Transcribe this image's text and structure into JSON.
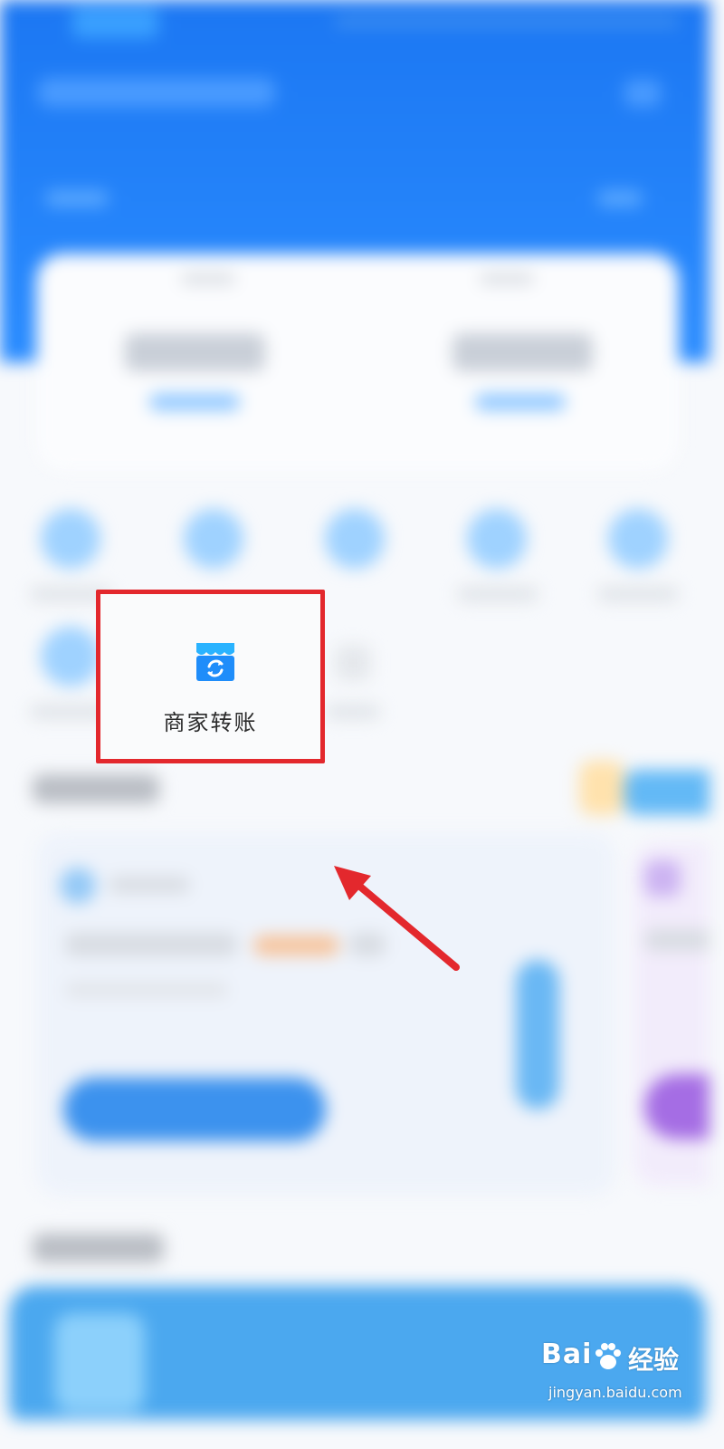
{
  "focus_item": {
    "label": "商家转账",
    "icon": "shop-transfer-icon",
    "highlight_color": "#e3282d",
    "icon_color": "#1f8dfa"
  },
  "annotation": {
    "arrow_color": "#e3282d"
  },
  "watermark": {
    "brand": "Bai",
    "brand_suffix": "经验",
    "url": "jingyan.baidu.com"
  },
  "colors": {
    "header": "#1b76f2",
    "accent": "#1f8dfa"
  }
}
